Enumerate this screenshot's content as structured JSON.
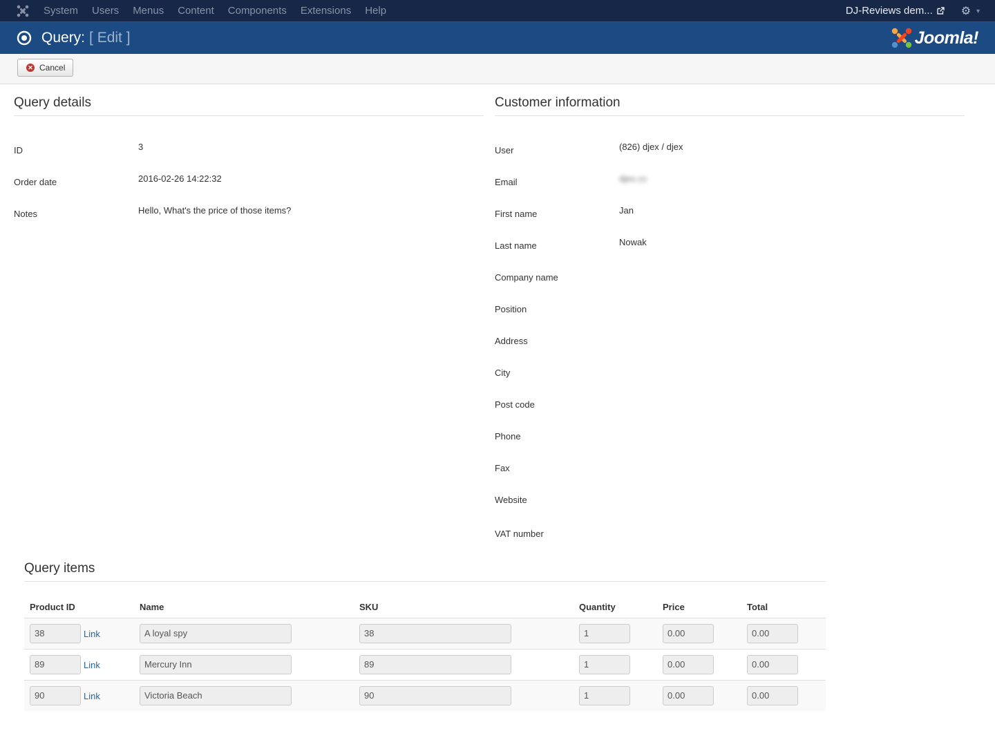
{
  "nav": {
    "items": [
      {
        "id": "system",
        "label": "System"
      },
      {
        "id": "users",
        "label": "Users"
      },
      {
        "id": "menus",
        "label": "Menus"
      },
      {
        "id": "content",
        "label": "Content"
      },
      {
        "id": "components",
        "label": "Components"
      },
      {
        "id": "extensions",
        "label": "Extensions"
      },
      {
        "id": "help",
        "label": "Help"
      }
    ],
    "site_label": "DJ-Reviews dem...",
    "logo_icon": "joomla-icon",
    "settings_icon": "gear-icon"
  },
  "header": {
    "title": "Query:",
    "edit": "[ Edit ]",
    "brand": "Joomla!"
  },
  "toolbar": {
    "cancel_label": "Cancel"
  },
  "query_details": {
    "title": "Query details",
    "fields": [
      {
        "label": "ID",
        "value": "3"
      },
      {
        "label": "Order date",
        "value": "2016-02-26 14:22:32"
      },
      {
        "label": "Notes",
        "value": "Hello, What's the price of those items?"
      }
    ]
  },
  "customer": {
    "title": "Customer information",
    "fields": [
      {
        "label": "User",
        "value": "(826) djex / djex"
      },
      {
        "label": "Email",
        "value": "djex.cc"
      },
      {
        "label": "First name",
        "value": "Jan"
      },
      {
        "label": "Last name",
        "value": "Nowak"
      },
      {
        "label": "Company name",
        "value": ""
      },
      {
        "label": "Position",
        "value": ""
      },
      {
        "label": "Address",
        "value": ""
      },
      {
        "label": "City",
        "value": ""
      },
      {
        "label": "Post code",
        "value": ""
      },
      {
        "label": "Phone",
        "value": ""
      },
      {
        "label": "Fax",
        "value": ""
      },
      {
        "label": "Website",
        "value": ""
      },
      {
        "label": "VAT number",
        "value": ""
      }
    ]
  },
  "items": {
    "title": "Query items",
    "columns": [
      "Product ID",
      "Name",
      "SKU",
      "Quantity",
      "Price",
      "Total"
    ],
    "link_label": "Link",
    "rows": [
      {
        "product_id": "38",
        "name": "A loyal spy",
        "sku": "38",
        "quantity": "1",
        "price": "0.00",
        "total": "0.00"
      },
      {
        "product_id": "89",
        "name": "Mercury Inn",
        "sku": "89",
        "quantity": "1",
        "price": "0.00",
        "total": "0.00"
      },
      {
        "product_id": "90",
        "name": "Victoria Beach",
        "sku": "90",
        "quantity": "1",
        "price": "0.00",
        "total": "0.00"
      }
    ]
  }
}
